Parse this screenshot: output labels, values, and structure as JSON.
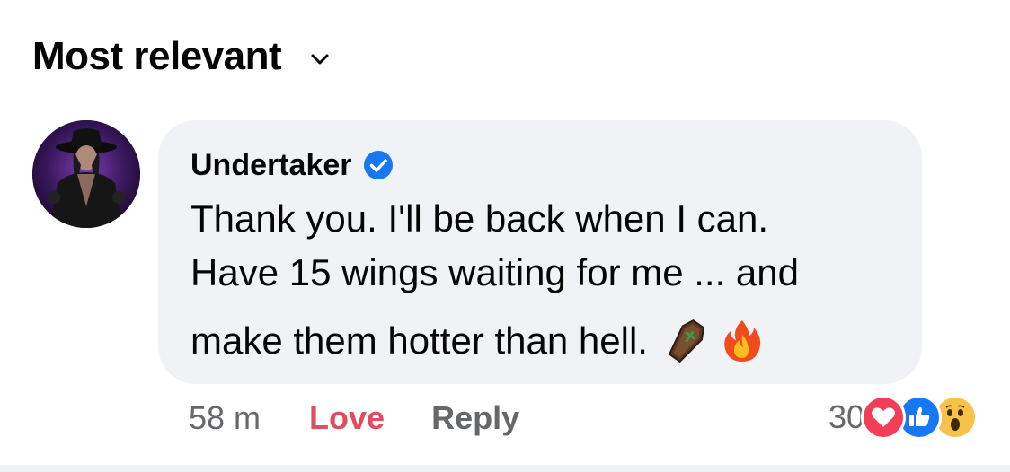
{
  "sort": {
    "label": "Most relevant",
    "chevron_icon": "chevron-down-icon"
  },
  "comment": {
    "author": "Undertaker",
    "verified": true,
    "verified_color": "#1877f2",
    "text_line1": "Thank you. I'll be back when I can.",
    "text_line2": "Have 15 wings waiting for me ... and",
    "text_line3": "make them hotter than hell.",
    "emojis": [
      "coffin-emoji",
      "fire-emoji"
    ],
    "timestamp": "58 m",
    "love_label": "Love",
    "reply_label": "Reply",
    "reaction_count": "30",
    "reaction_icons": [
      "love-reaction-icon",
      "like-reaction-icon",
      "wow-reaction-icon"
    ]
  },
  "colors": {
    "bubble_bg": "#f0f2f5",
    "love": "#e34b5e",
    "muted": "#65676b",
    "like": "#1877f2"
  }
}
